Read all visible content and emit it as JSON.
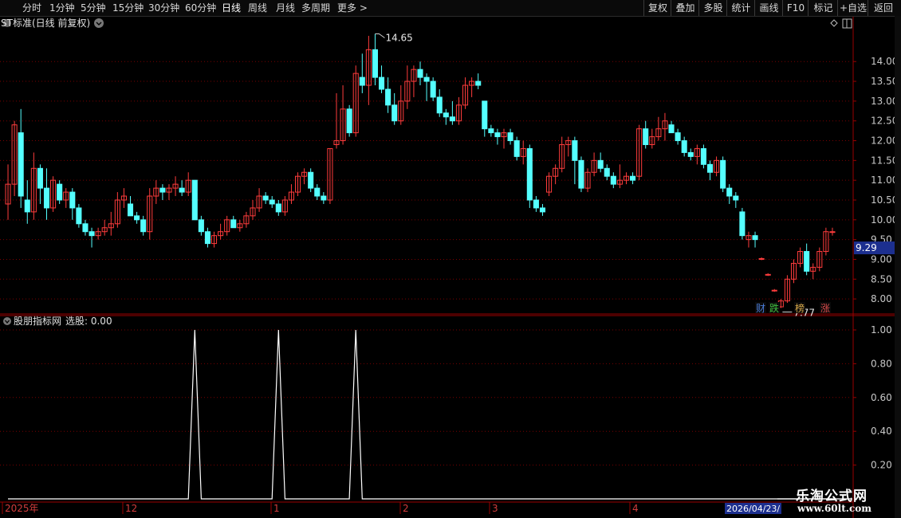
{
  "toolbar": {
    "left_items": [
      "分时",
      "1分钟",
      "5分钟",
      "15分钟",
      "30分钟",
      "60分钟",
      "日线",
      "周线",
      "月线",
      "多周期",
      "更多"
    ],
    "active": "日线",
    "right_items": [
      "复权",
      "叠加",
      "多股",
      "统计",
      "画线",
      "F10",
      "标记",
      "+自选",
      "返回"
    ]
  },
  "main_panel": {
    "title": "ST标准(日线 前复权)",
    "price_axis": [
      "14.00",
      "13.50",
      "13.00",
      "12.50",
      "12.00",
      "11.50",
      "11.00",
      "10.50",
      "10.00",
      "9.50",
      "9.00",
      "8.50",
      "8.00"
    ],
    "current_price": "9.29",
    "high_label": "14.65",
    "low_label": "7.77",
    "badges": [
      {
        "text": "财",
        "color": "#4a7bd6"
      },
      {
        "text": "跌",
        "color": "#3fbf3f"
      },
      {
        "text": "榜",
        "color": "#d6a84a"
      },
      {
        "text": "涨",
        "color": "#d64a4a"
      }
    ]
  },
  "indicator_panel": {
    "title": "股朋指标网",
    "select_label": "选股: 0.00",
    "axis": [
      "1.00",
      "0.80",
      "0.60",
      "0.40",
      "0.20"
    ]
  },
  "date_axis": {
    "labels": [
      "2025年",
      "12",
      "1",
      "2",
      "3",
      "4"
    ],
    "current_date": "2026/04/23/"
  },
  "watermark": {
    "title": "乐淘公式网",
    "url": "www.60lt.com"
  },
  "colors": {
    "up": "#ff3c3c",
    "down": "#54ffff",
    "grid": "#7a0000",
    "axis_text": "#c8c8c8",
    "price_box": "#1c2f8f"
  },
  "chart_data": [
    {
      "type": "candlestick",
      "title": "ST标准(日线 前复权)",
      "ylim": [
        7.7,
        14.75
      ],
      "candles": [
        [
          10.4,
          11.4,
          10.0,
          10.9
        ],
        [
          10.9,
          12.5,
          10.6,
          12.4
        ],
        [
          12.2,
          12.8,
          10.3,
          10.6
        ],
        [
          10.5,
          11.0,
          9.9,
          10.2
        ],
        [
          10.2,
          11.7,
          10.0,
          11.3
        ],
        [
          11.3,
          11.4,
          10.4,
          10.8
        ],
        [
          10.8,
          11.3,
          10.0,
          10.3
        ],
        [
          10.3,
          11.1,
          10.2,
          11.0
        ],
        [
          10.9,
          11.0,
          10.4,
          10.5
        ],
        [
          10.5,
          10.8,
          10.3,
          10.7
        ],
        [
          10.7,
          10.8,
          10.0,
          10.3
        ],
        [
          10.3,
          10.4,
          9.8,
          9.9
        ],
        [
          9.9,
          10.0,
          9.6,
          9.7
        ],
        [
          9.7,
          9.8,
          9.3,
          9.6
        ],
        [
          9.6,
          9.8,
          9.5,
          9.7
        ],
        [
          9.7,
          10.0,
          9.6,
          9.8
        ],
        [
          9.8,
          10.2,
          9.6,
          9.9
        ],
        [
          9.9,
          10.7,
          9.8,
          10.5
        ],
        [
          10.5,
          10.8,
          10.3,
          10.6
        ],
        [
          10.4,
          10.6,
          10.2,
          10.1
        ],
        [
          10.1,
          10.2,
          9.9,
          10.0
        ],
        [
          10.0,
          10.1,
          9.6,
          9.7
        ],
        [
          9.7,
          10.8,
          9.5,
          10.6
        ],
        [
          10.6,
          11.0,
          10.4,
          10.8
        ],
        [
          10.8,
          10.9,
          10.5,
          10.7
        ],
        [
          10.7,
          10.9,
          10.5,
          10.8
        ],
        [
          10.8,
          11.1,
          10.6,
          10.9
        ],
        [
          10.8,
          11.0,
          10.6,
          10.7
        ],
        [
          10.7,
          11.2,
          10.6,
          11.0
        ],
        [
          11.0,
          11.0,
          10.0,
          10.0
        ],
        [
          10.0,
          10.1,
          9.6,
          9.7
        ],
        [
          9.7,
          9.8,
          9.3,
          9.4
        ],
        [
          9.4,
          9.7,
          9.3,
          9.6
        ],
        [
          9.6,
          9.9,
          9.5,
          9.7
        ],
        [
          9.7,
          10.1,
          9.6,
          10.0
        ],
        [
          10.0,
          10.1,
          9.8,
          9.8
        ],
        [
          9.8,
          10.0,
          9.7,
          9.9
        ],
        [
          9.9,
          10.2,
          9.8,
          10.1
        ],
        [
          10.1,
          10.5,
          10.0,
          10.3
        ],
        [
          10.3,
          10.8,
          10.2,
          10.6
        ],
        [
          10.6,
          10.7,
          10.4,
          10.5
        ],
        [
          10.5,
          10.6,
          10.3,
          10.4
        ],
        [
          10.4,
          10.5,
          10.1,
          10.2
        ],
        [
          10.2,
          10.6,
          10.1,
          10.5
        ],
        [
          10.5,
          10.9,
          10.4,
          10.7
        ],
        [
          10.7,
          11.2,
          10.6,
          11.1
        ],
        [
          11.1,
          11.3,
          10.9,
          11.2
        ],
        [
          11.2,
          11.3,
          10.7,
          10.8
        ],
        [
          10.8,
          10.9,
          10.5,
          10.6
        ],
        [
          10.6,
          10.7,
          10.4,
          10.5
        ],
        [
          10.5,
          11.8,
          10.4,
          11.8
        ],
        [
          11.9,
          13.2,
          11.8,
          12.0
        ],
        [
          12.0,
          13.4,
          11.9,
          12.8
        ],
        [
          12.8,
          12.9,
          12.1,
          12.2
        ],
        [
          12.2,
          13.9,
          12.1,
          13.7
        ],
        [
          13.6,
          14.2,
          13.2,
          13.4
        ],
        [
          13.4,
          14.65,
          12.9,
          14.3
        ],
        [
          14.3,
          14.7,
          13.4,
          13.6
        ],
        [
          13.6,
          13.9,
          13.2,
          13.3
        ],
        [
          13.3,
          13.6,
          12.7,
          12.9
        ],
        [
          12.9,
          13.2,
          12.4,
          12.5
        ],
        [
          12.5,
          13.4,
          12.4,
          13.0
        ],
        [
          13.0,
          13.9,
          12.8,
          13.5
        ],
        [
          13.5,
          13.9,
          13.1,
          13.8
        ],
        [
          13.8,
          14.0,
          13.4,
          13.6
        ],
        [
          13.6,
          13.7,
          13.0,
          13.5
        ],
        [
          13.5,
          13.6,
          13.0,
          13.1
        ],
        [
          13.1,
          13.3,
          12.6,
          12.7
        ],
        [
          12.7,
          12.8,
          12.4,
          12.6
        ],
        [
          12.6,
          13.0,
          12.4,
          12.5
        ],
        [
          12.5,
          13.1,
          12.4,
          12.9
        ],
        [
          12.9,
          13.6,
          12.8,
          13.4
        ],
        [
          13.4,
          13.6,
          13.1,
          13.5
        ],
        [
          13.5,
          13.7,
          13.3,
          13.4
        ],
        [
          13.0,
          13.0,
          12.1,
          12.3
        ],
        [
          12.3,
          12.4,
          12.1,
          12.2
        ],
        [
          12.2,
          12.3,
          11.9,
          12.1
        ],
        [
          12.1,
          12.3,
          11.8,
          12.2
        ],
        [
          12.2,
          12.3,
          11.9,
          12.0
        ],
        [
          12.0,
          12.1,
          11.5,
          11.6
        ],
        [
          11.6,
          12.0,
          11.4,
          11.8
        ],
        [
          11.8,
          11.9,
          10.3,
          10.5
        ],
        [
          10.5,
          10.6,
          10.2,
          10.3
        ],
        [
          10.3,
          10.4,
          10.1,
          10.2
        ],
        [
          10.7,
          11.2,
          10.6,
          11.1
        ],
        [
          11.1,
          11.4,
          10.9,
          11.3
        ],
        [
          11.3,
          12.1,
          11.2,
          11.9
        ],
        [
          11.9,
          12.1,
          11.6,
          12.0
        ],
        [
          12.0,
          12.1,
          10.9,
          11.5
        ],
        [
          11.5,
          11.6,
          10.7,
          10.8
        ],
        [
          10.8,
          11.3,
          10.7,
          11.2
        ],
        [
          11.2,
          11.7,
          11.1,
          11.5
        ],
        [
          11.5,
          11.7,
          11.2,
          11.3
        ],
        [
          11.3,
          11.4,
          11.0,
          11.1
        ],
        [
          11.1,
          11.2,
          10.8,
          10.9
        ],
        [
          10.9,
          11.4,
          10.8,
          11.0
        ],
        [
          11.0,
          11.2,
          10.9,
          11.1
        ],
        [
          11.1,
          11.2,
          10.9,
          11.0
        ],
        [
          11.1,
          12.4,
          11.0,
          12.3
        ],
        [
          12.3,
          12.5,
          11.8,
          11.9
        ],
        [
          11.9,
          12.3,
          11.8,
          12.1
        ],
        [
          12.1,
          12.6,
          12.0,
          12.3
        ],
        [
          12.3,
          12.7,
          12.0,
          12.5
        ],
        [
          12.4,
          12.5,
          12.2,
          12.2
        ],
        [
          12.2,
          12.3,
          11.9,
          12.0
        ],
        [
          12.0,
          12.1,
          11.6,
          11.7
        ],
        [
          11.7,
          11.8,
          11.5,
          11.6
        ],
        [
          11.6,
          11.9,
          11.4,
          11.8
        ],
        [
          11.8,
          11.9,
          11.3,
          11.4
        ],
        [
          11.4,
          11.5,
          11.0,
          11.2
        ],
        [
          11.2,
          11.6,
          11.1,
          11.5
        ],
        [
          11.5,
          11.6,
          10.7,
          10.8
        ],
        [
          10.8,
          10.9,
          10.4,
          10.6
        ],
        [
          10.6,
          10.7,
          10.3,
          10.5
        ],
        [
          10.2,
          10.3,
          9.5,
          9.6
        ],
        [
          9.5,
          9.7,
          9.3,
          9.6
        ],
        [
          9.6,
          9.7,
          9.3,
          9.5
        ],
        [
          9.0,
          9.05,
          8.98,
          9.02
        ],
        [
          8.6,
          8.65,
          8.58,
          8.62
        ],
        [
          8.2,
          8.25,
          8.18,
          8.22
        ],
        [
          7.8,
          8.0,
          7.77,
          7.95
        ],
        [
          7.95,
          8.6,
          7.9,
          8.5
        ],
        [
          8.5,
          9.0,
          8.4,
          8.9
        ],
        [
          8.9,
          9.3,
          8.8,
          9.2
        ],
        [
          9.2,
          9.4,
          8.6,
          8.7
        ],
        [
          8.7,
          8.9,
          8.5,
          8.8
        ],
        [
          8.8,
          9.3,
          8.7,
          9.2
        ],
        [
          9.2,
          9.8,
          9.1,
          9.7
        ],
        [
          9.7,
          9.8,
          9.6,
          9.7
        ]
      ]
    },
    {
      "type": "line",
      "title": "股朋指标网",
      "ylim": [
        0,
        1.0
      ],
      "series": [
        {
          "values": [
            0,
            0,
            0,
            0,
            0,
            0,
            0,
            0,
            0,
            0,
            0,
            0,
            0,
            0,
            0,
            0,
            0,
            0,
            0,
            0,
            0,
            0,
            0,
            0,
            0,
            0,
            0,
            0,
            0,
            1,
            0,
            0,
            0,
            0,
            0,
            0,
            0,
            0,
            0,
            0,
            0,
            0,
            1,
            0,
            0,
            0,
            0,
            0,
            0,
            0,
            0,
            0,
            0,
            0,
            1,
            0,
            0,
            0,
            0,
            0,
            0,
            0,
            0,
            0,
            0,
            0,
            0,
            0,
            0,
            0,
            0,
            0,
            0,
            0,
            0,
            0,
            0,
            0,
            0,
            0,
            0,
            0,
            0,
            0,
            0,
            0,
            0,
            0,
            0,
            0,
            0,
            0,
            0,
            0,
            0,
            0,
            0,
            0,
            0,
            0,
            0,
            0,
            0,
            0,
            0,
            0,
            0,
            0,
            0,
            0,
            0,
            0,
            0,
            0,
            0,
            0,
            0,
            0,
            0,
            0,
            0,
            0,
            0,
            0,
            0,
            0,
            0,
            0,
            0
          ]
        }
      ]
    }
  ]
}
